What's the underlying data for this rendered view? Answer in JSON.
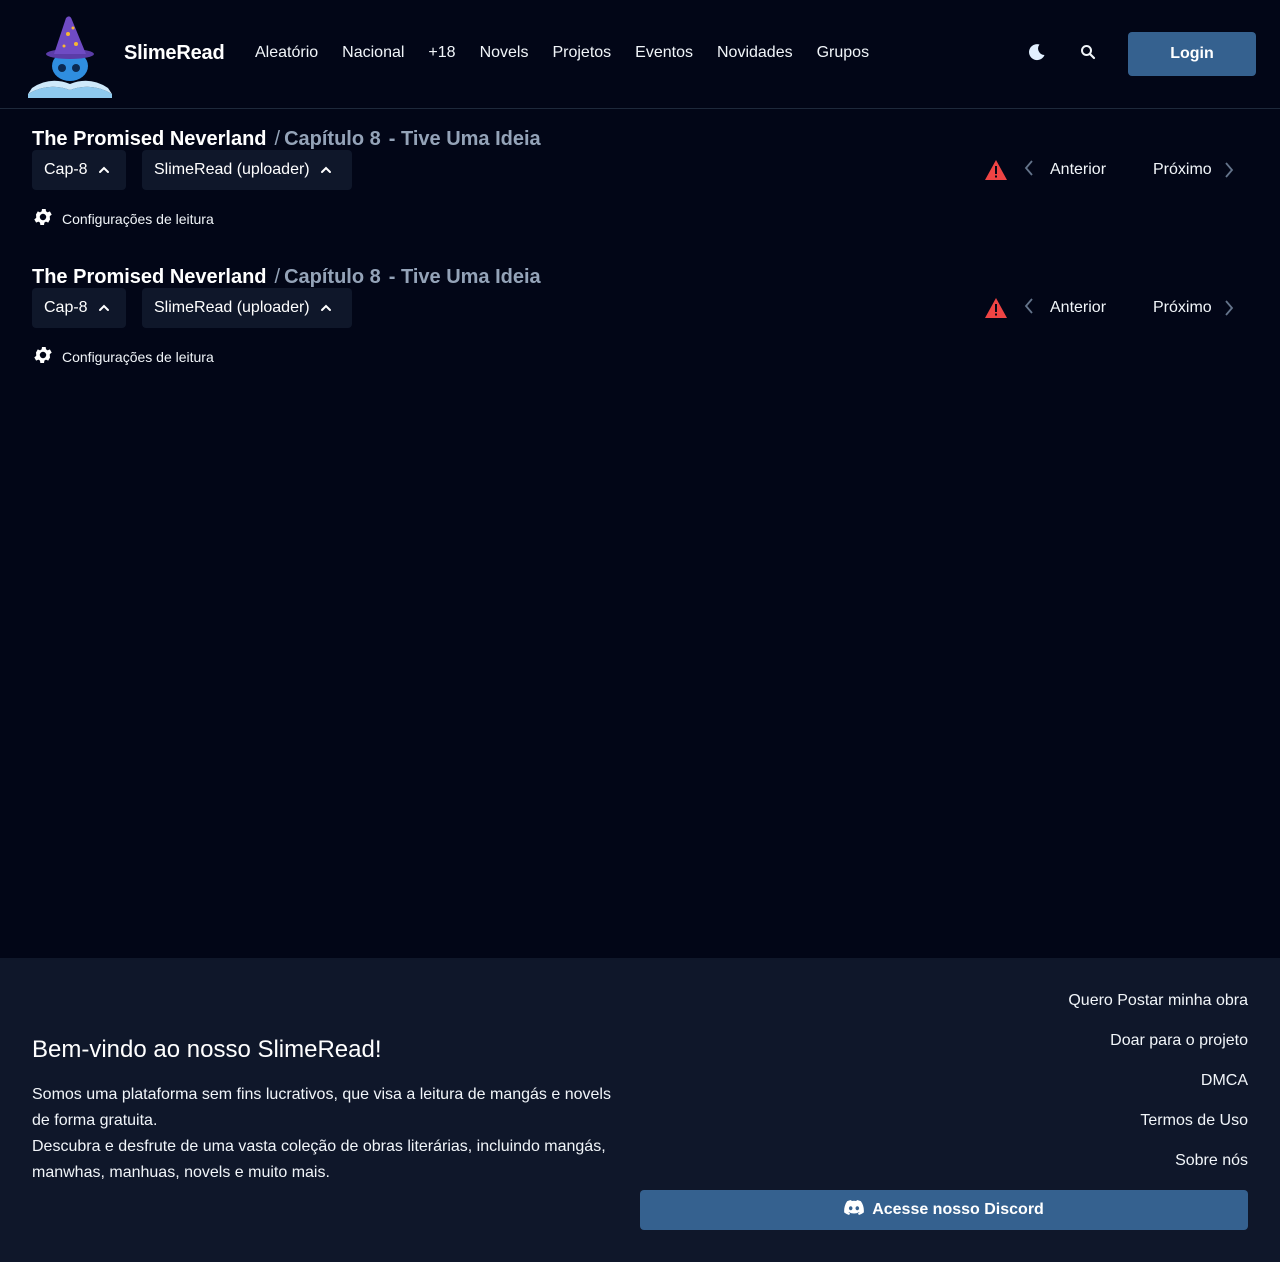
{
  "header": {
    "brand": "SlimeRead",
    "nav": [
      "Aleatório",
      "Nacional",
      "+18",
      "Novels",
      "Projetos",
      "Eventos",
      "Novidades",
      "Grupos"
    ],
    "login_label": "Login"
  },
  "reader": {
    "series_title": "The Promised Neverland",
    "separator": "/",
    "chapter_label": "Capítulo 8",
    "chapter_name": "- Tive Uma Ideia",
    "chapter_select": "Cap-8",
    "group_select": "SlimeRead (uploader)",
    "prev_label": "Anterior",
    "next_label": "Próximo",
    "settings_label": "Configurações de leitura"
  },
  "footer": {
    "welcome": "Bem-vindo ao nosso SlimeRead!",
    "about_line1": "Somos uma plataforma sem fins lucrativos, que visa a leitura de mangás e novels de forma gratuita.",
    "about_line2": "Descubra e desfrute de uma vasta coleção de obras literárias, incluindo mangás, manwhas, manhuas, novels e muito mais.",
    "links": [
      "Quero Postar minha obra",
      "Doar para o projeto",
      "DMCA",
      "Termos de Uso",
      "Sobre nós"
    ],
    "discord_label": "Acesse nosso Discord"
  },
  "colors": {
    "background": "#020617",
    "footer_bg": "#0f172a",
    "accent": "#35618f",
    "warning": "#ef4444",
    "muted": "#94a3b8"
  },
  "icons": {
    "logo": "slime-wizard-logo",
    "theme": "moon-icon",
    "search": "search-icon",
    "select": "chevron-up-icon",
    "report": "warning-icon",
    "prev": "chevron-left-icon",
    "next": "chevron-right-icon",
    "settings": "gear-icon",
    "discord": "discord-icon"
  }
}
